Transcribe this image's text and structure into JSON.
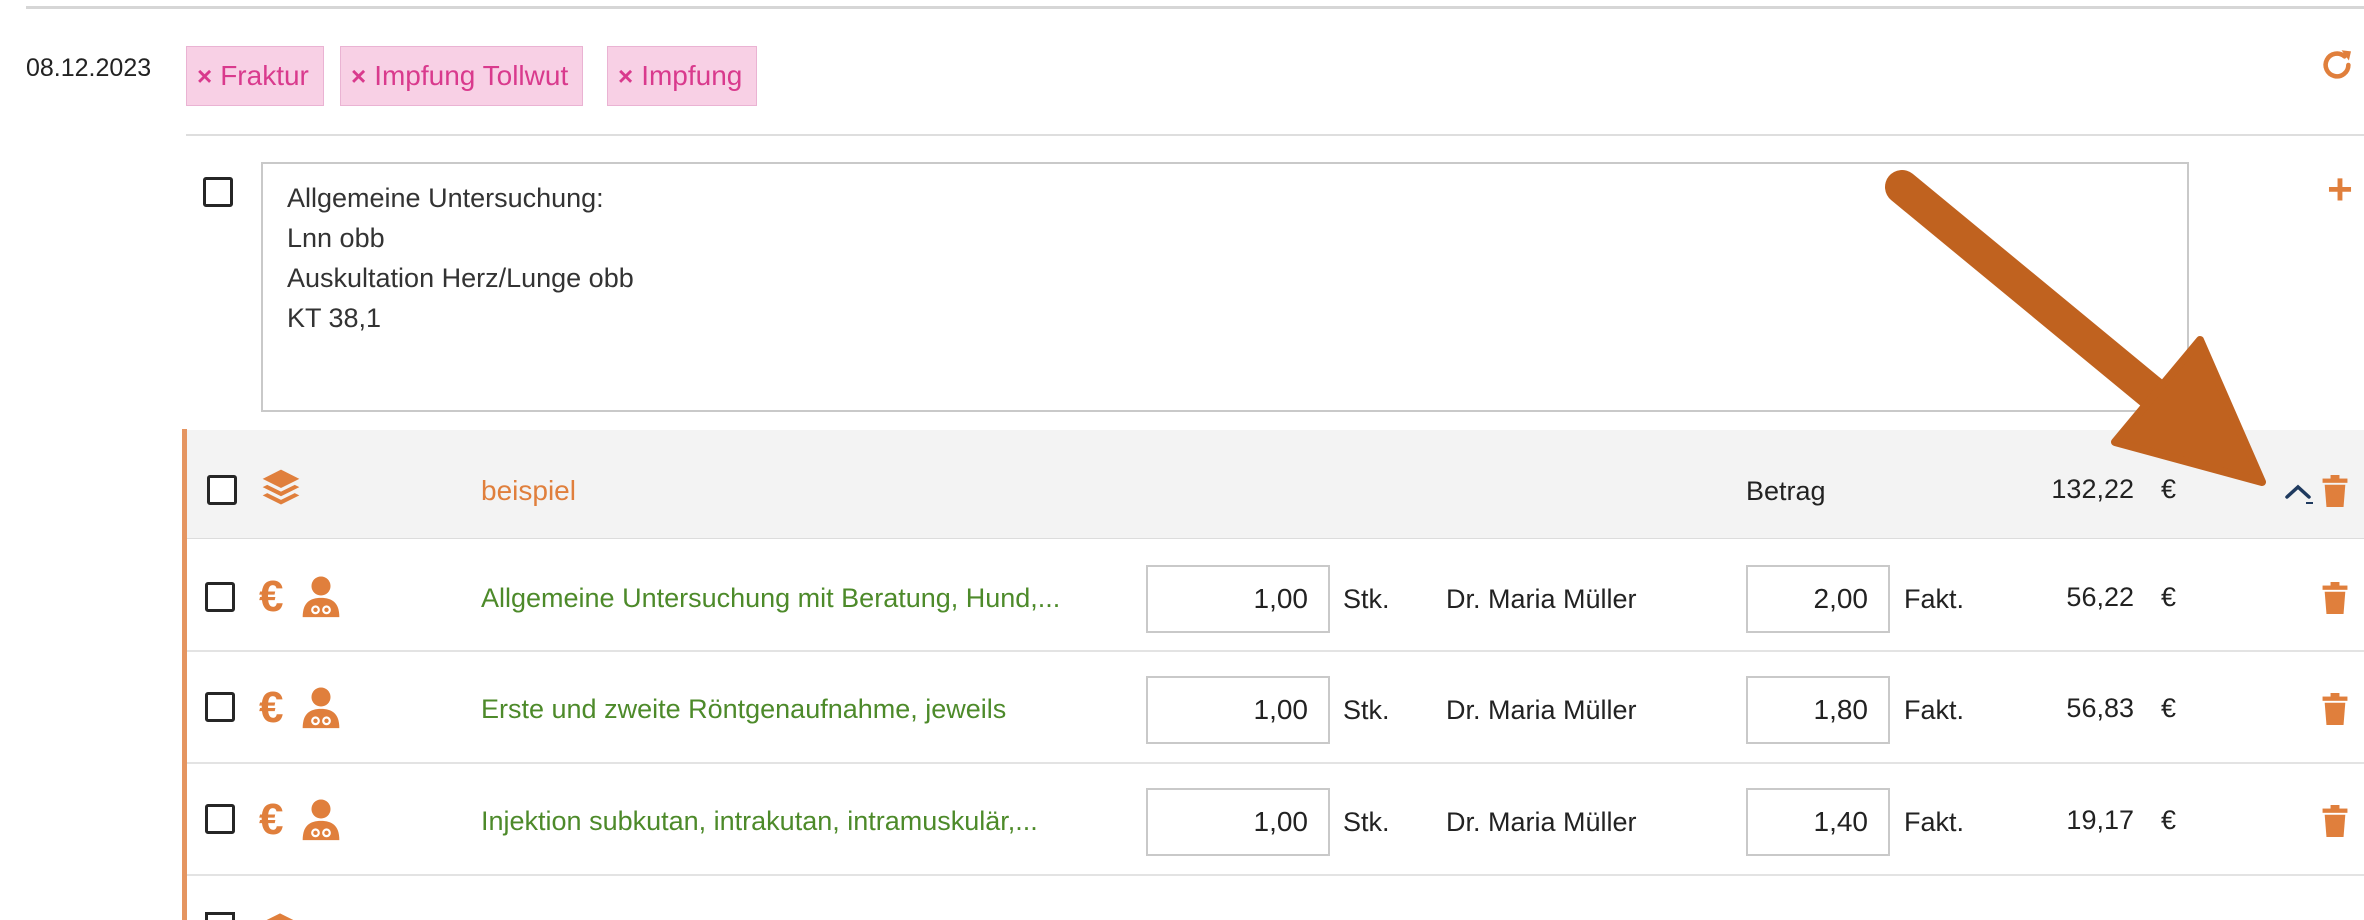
{
  "entry": {
    "date": "08.12.2023",
    "tags": [
      {
        "label": "Fraktur"
      },
      {
        "label": "Impfung Tollwut"
      },
      {
        "label": "Impfung"
      }
    ],
    "notes": "Allgemeine Untersuchung:\nLnn obb\nAuskultation Herz/Lunge obb\nKT 38,1"
  },
  "group": {
    "name": "beispiel",
    "amount_label": "Betrag",
    "amount": "132,22",
    "currency": "€"
  },
  "items": [
    {
      "title": "Allgemeine Untersuchung mit Beratung, Hund,...",
      "quantity": "1,00",
      "unit": "Stk.",
      "doctor": "Dr. Maria Müller",
      "factor": "2,00",
      "factor_label": "Fakt.",
      "price": "56,22",
      "currency": "€"
    },
    {
      "title": "Erste und zweite Röntgenaufnahme, jeweils",
      "quantity": "1,00",
      "unit": "Stk.",
      "doctor": "Dr. Maria Müller",
      "factor": "1,80",
      "factor_label": "Fakt.",
      "price": "56,83",
      "currency": "€"
    },
    {
      "title": "Injektion subkutan, intrakutan, intramuskulär,...",
      "quantity": "1,00",
      "unit": "Stk.",
      "doctor": "Dr. Maria Müller",
      "factor": "1,40",
      "factor_label": "Fakt.",
      "price": "19,17",
      "currency": "€"
    }
  ],
  "icons": {
    "tag_remove": "×",
    "refresh": "refresh-icon",
    "add": "+",
    "layers": "layers-icon",
    "euro": "€",
    "doctor": "doctor-icon",
    "collapse": "chevron-up-icon",
    "delete": "trash-icon"
  },
  "colors": {
    "accent": "#e07f3c",
    "tag_bg": "#f8d0e5",
    "tag_text": "#d93a8d",
    "item_text": "#4d8a2a",
    "annotation_arrow": "#c0621f"
  }
}
